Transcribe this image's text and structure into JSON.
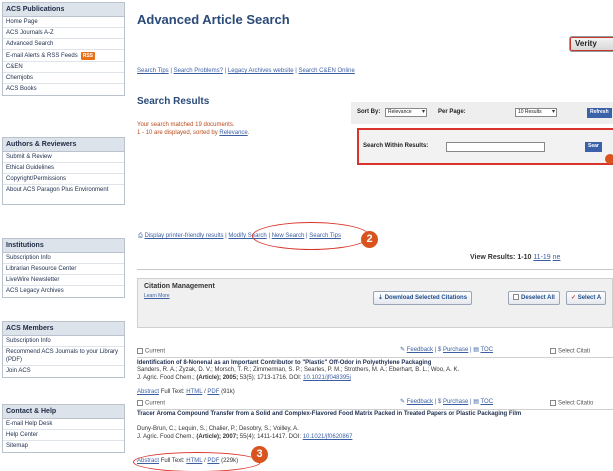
{
  "sidebar": {
    "sections": [
      {
        "heading": "ACS Publications",
        "items": [
          "Home Page",
          "ACS Journals A-Z",
          "Advanced Search",
          "E-mail Alerts & RSS Feeds",
          "C&EN",
          "Chemjobs",
          "ACS Books"
        ],
        "rss_badge": "RSS"
      },
      {
        "heading": "Authors & Reviewers",
        "items": [
          "Submit & Review",
          "Ethical Guidelines",
          "Copyright/Permissions",
          "About ACS Paragon Plus Environment"
        ]
      },
      {
        "heading": "Institutions",
        "items": [
          "Subscription Info",
          "Librarian Resource Center",
          "LiveWire Newsletter",
          "ACS Legacy Archives"
        ]
      },
      {
        "heading": "ACS Members",
        "items": [
          "Subscription Info",
          "Recommend ACS Journals to your Library (PDF)",
          "Join ACS"
        ]
      },
      {
        "heading": "Contact & Help",
        "items": [
          "E-mail Help Desk",
          "Help Center",
          "Sitemap"
        ]
      }
    ]
  },
  "main": {
    "title": "Advanced Article Search",
    "verity_button": "Verity",
    "top_links": [
      "Search Tips",
      "Search Problems?",
      "Legacy Archives website",
      "Search C&EN Online"
    ],
    "results_heading": "Search Results",
    "matched_line1": "Your search matched 19 documents.",
    "matched_line2": "1 - 10 are displayed, sorted by",
    "sorted_by_link": "Relevance",
    "sort_by_label": "Sort By:",
    "sort_by_value": "Relevance",
    "per_page_label": "Per Page:",
    "per_page_value": "10 Results",
    "refresh_button": "Refresh",
    "search_within_label": "Search Within Results:",
    "search_within_value": "",
    "search_button": "Sear",
    "callout_2": "2",
    "callout_3": "3",
    "actions": [
      "Display printer-friendly results",
      "Modify Search",
      "New Search",
      "Search Tips"
    ],
    "view_results_label": "View Results:",
    "view_results_current": "1-10",
    "view_results_next_range": "11-19",
    "view_results_next": "ne",
    "citation": {
      "title": "Citation Management",
      "learn_more": "Learn More",
      "download_button": "Download Selected Citations",
      "deselect_button": "Deselect All",
      "select_button": "Select A"
    },
    "articles": [
      {
        "status": "Current",
        "feedback": "Feedback",
        "purchase": "Purchase",
        "toc": "TOC",
        "select": "Select Citati",
        "title": "Identification of 8-Nonenal as an Important Contributor to \"Plastic\" Off-Odor in Polyethylene Packaging",
        "authors": "Sanders, R. A.; Zyzak, D. V.; Morsch, T. R.; Zimmerman, S. P.; Searles, P. M.; Strothers, M. A.; Eberhart, B. L.; Woo, A. K.",
        "journal_pre": "J. Agric. Food Chem.;",
        "journal_art": "(Article);",
        "journal_year": "2005;",
        "journal_rest": "53(5); 1713-1716.  DOI:",
        "doi": "10.1021/jf048395j",
        "abstract": "Abstract",
        "fulltext": "Full Text:",
        "html": "HTML",
        "pdf": "PDF",
        "size": "(91k)"
      },
      {
        "status": "Current",
        "feedback": "Feedback",
        "purchase": "Purchase",
        "toc": "TOC",
        "select": "Select Citatio",
        "title": "Tracer Aroma Compound Transfer from a Solid and Complex-Flavored Food Matrix Packed in Treated Papers or Plastic Packaging Film",
        "authors": "Duny-Brun, C.; Lequin, S.; Chalier, P.; Desobry, S.; Voilley, A.",
        "journal_pre": "J. Agric. Food Chem.;",
        "journal_art": "(Article);",
        "journal_year": "2007;",
        "journal_rest": "55(4); 1411-1417.  DOI:",
        "doi": "10.1021/jf0620867",
        "abstract": "Abstract",
        "fulltext": "Full Text:",
        "html": "HTML",
        "pdf": "PDF",
        "size": "(229k)"
      }
    ]
  }
}
